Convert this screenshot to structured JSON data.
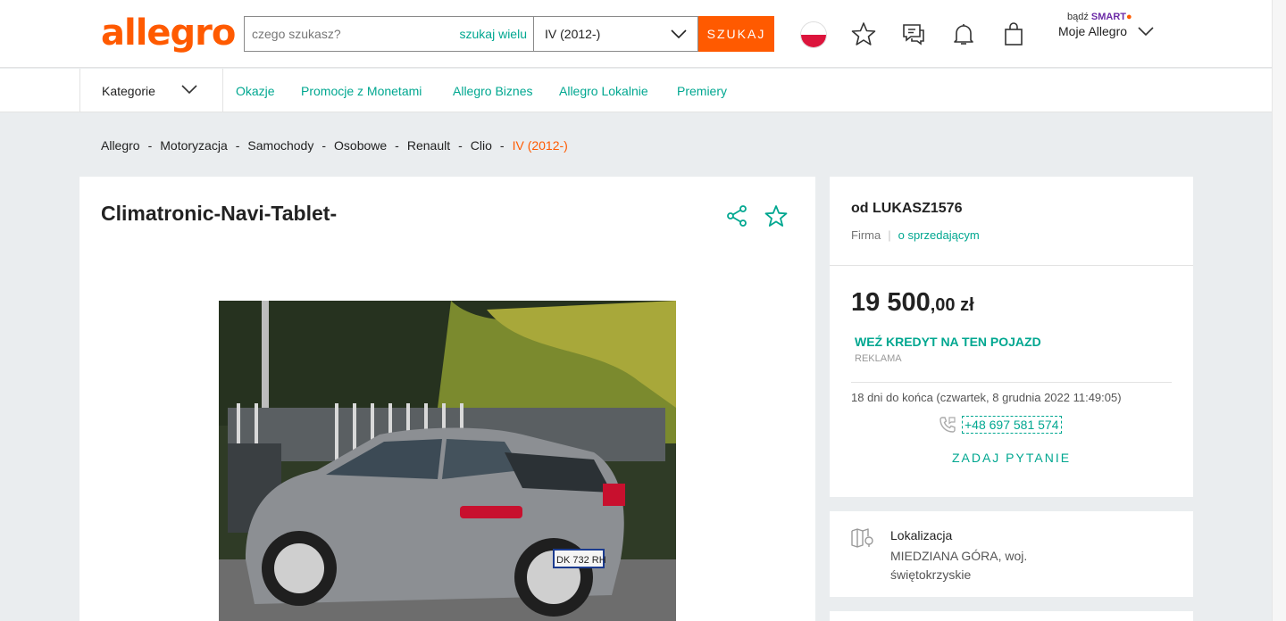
{
  "header": {
    "logo": "allegro",
    "search_placeholder": "czego szukasz?",
    "search_many": "szukaj wielu",
    "category_select": "IV (2012-)",
    "search_button": "SZUKAJ",
    "smart_prefix": "bądź",
    "smart_label": "SMART",
    "my_allegro": "Moje Allegro"
  },
  "nav": {
    "categories": "Kategorie",
    "links": [
      "Okazje",
      "Promocje z Monetami",
      "Allegro Biznes",
      "Allegro Lokalnie",
      "Premiery"
    ]
  },
  "breadcrumb": [
    "Allegro",
    "Motoryzacja",
    "Samochody",
    "Osobowe",
    "Renault",
    "Clio",
    "IV (2012-)"
  ],
  "listing": {
    "title": "Climatronic-Navi-Tablet-",
    "plate": "DK 732 RH"
  },
  "seller": {
    "name": "od LUKASZ1576",
    "type": "Firma",
    "about_link": "o sprzedającym"
  },
  "offer": {
    "price_main": "19 500",
    "price_cents": ",00 zł",
    "credit": "WEŹ KREDYT NA TEN POJAZD",
    "ad_label": "REKLAMA",
    "ends": "18 dni do końca (czwartek, 8 grudnia 2022 11:49:05)",
    "phone": "+48 697 581 574",
    "ask": "ZADAJ PYTANIE"
  },
  "location": {
    "title": "Lokalizacja",
    "value": "MIEDZIANA GÓRA, woj. świętokrzyskie"
  },
  "colors": {
    "brand": "#ff5a00",
    "accent": "#00a790",
    "smart": "#6b2aa6"
  },
  "icons": [
    "flag-pl-icon",
    "star-icon",
    "chat-icon",
    "bell-icon",
    "bag-icon",
    "chevron-down-icon",
    "share-icon",
    "phone-icon",
    "map-icon"
  ]
}
